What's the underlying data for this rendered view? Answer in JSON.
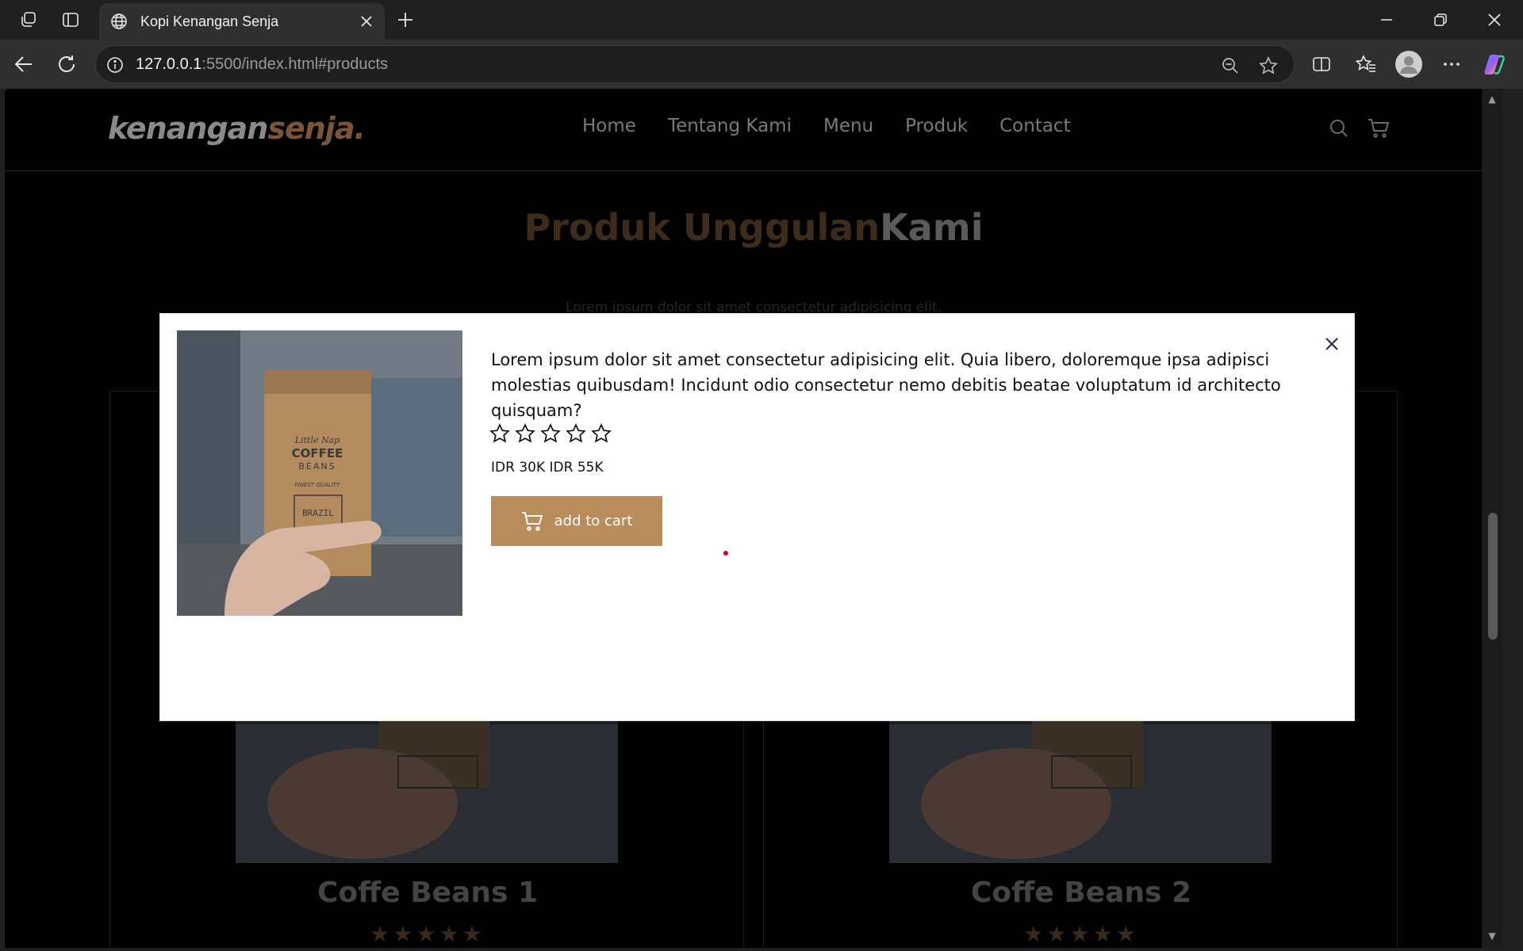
{
  "browser": {
    "tab_title": "Kopi Kenangan Senja",
    "url_host": "127.0.0.1",
    "url_rest": ":5500/index.html#products"
  },
  "site": {
    "logo_main": "kenangan",
    "logo_accent": "senja.",
    "menu": [
      "Home",
      "Tentang Kami",
      "Menu",
      "Produk",
      "Contact"
    ],
    "section_title_accent": "Produk Unggulan",
    "section_title_rest": "Kami",
    "section_subtitle": "Lorem ipsum dolor sit amet consectetur adipisicing elit.",
    "cards": [
      {
        "name": "Coffe Beans 1",
        "rating": 5
      },
      {
        "name": "Coffe Beans 2",
        "rating": 5
      }
    ]
  },
  "modal": {
    "description": "Lorem ipsum dolor sit amet consectetur adipisicing elit. Quia libero, doloremque ipsa adipisci molestias quibusdam! Incidunt odio consectetur nemo debitis beatae voluptatum id architecto quisquam?",
    "rating_filled": 0,
    "rating_max": 5,
    "price": "IDR 30K IDR 55K",
    "cart_label": "add to cart",
    "product_label_brand": "Little Nap",
    "product_label_title": "COFFEE",
    "product_label_sub": "BEANS",
    "product_label_quality": "FINEST QUALITY",
    "product_label_origin": "BRAZIL"
  },
  "colors": {
    "accent": "#b98c5c",
    "close_icon": "#3a1a5a",
    "indicator_dot": "#d0021b"
  }
}
